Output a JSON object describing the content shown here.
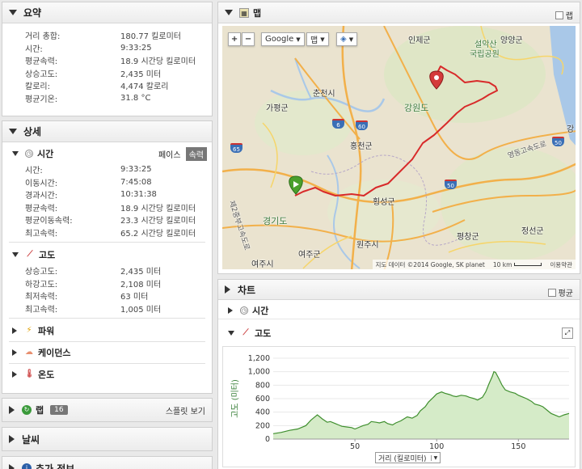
{
  "summary": {
    "title": "요약",
    "rows": [
      {
        "k": "거리 총합:",
        "v": "180.77 킬로미터"
      },
      {
        "k": "시간:",
        "v": "9:33:25"
      },
      {
        "k": "평균속력:",
        "v": "18.9 시간당 킬로미터"
      },
      {
        "k": "상승고도:",
        "v": "2,435 미터"
      },
      {
        "k": "칼로리:",
        "v": "4,474 칼로리"
      },
      {
        "k": "평균기온:",
        "v": "31.8 °C"
      }
    ]
  },
  "details": {
    "title": "상세",
    "time": {
      "title": "시간",
      "pace_label": "페이스",
      "speed_label": "속력",
      "rows": [
        {
          "k": "시간:",
          "v": "9:33:25"
        },
        {
          "k": "이동시간:",
          "v": "7:45:08"
        },
        {
          "k": "경과시간:",
          "v": "10:31:38"
        },
        {
          "k": "평균속력:",
          "v": "18.9 시간당 킬로미터"
        },
        {
          "k": "평균이동속력:",
          "v": "23.3 시간당 킬로미터"
        },
        {
          "k": "최고속력:",
          "v": "65.2 시간당 킬로미터"
        }
      ]
    },
    "elevation": {
      "title": "고도",
      "rows": [
        {
          "k": "상승고도:",
          "v": "2,435 미터"
        },
        {
          "k": "하강고도:",
          "v": "2,108 미터"
        },
        {
          "k": "최저속력:",
          "v": "63 미터"
        },
        {
          "k": "최고속력:",
          "v": "1,005 미터"
        }
      ]
    },
    "power": "파워",
    "cadence": "케이던스",
    "temperature": "온도"
  },
  "laps": {
    "title": "랩",
    "count": "16",
    "split_view": "스플릿 보기"
  },
  "weather": {
    "title": "날씨"
  },
  "extra": {
    "title": "추가 정보"
  },
  "map": {
    "title": "맵",
    "lap_checkbox": "랩",
    "zoom_in": "+",
    "zoom_out": "−",
    "provider": "Google",
    "type": "맵",
    "attribution": "지도 데이터 ©2014 Google, SK planet",
    "scale": "10 km",
    "terms": "이용약관",
    "labels": {
      "inje": "인제군",
      "yangyang": "양양군",
      "seorak": "설악산",
      "park": "국립공원",
      "chuncheon": "춘천시",
      "gapyeong": "가평군",
      "gangwon": "강원도",
      "hongcheon": "홍천군",
      "gyeonggi": "경기도",
      "hoengseong": "횡성군",
      "wonju": "원주시",
      "yeoju": "여주군",
      "pyeongchang": "평창군",
      "jeongseon": "정선군",
      "yeosu": "여주시",
      "gang": "강",
      "expressway1": "영동고속도로",
      "expressway2": "제2중부고속도로",
      "route_6": "6",
      "route_60": "60",
      "route_65": "65",
      "route_50": "50"
    }
  },
  "chart": {
    "title": "차트",
    "avg_checkbox": "평균",
    "time_section": "시간",
    "elevation_section": "고도",
    "xaxis_select": "거리 (킬로미터)"
  },
  "chart_data": {
    "type": "area",
    "ylabel": "고도 (미터)",
    "xlabel": "거리 (킬로미터)",
    "xlim": [
      0,
      181
    ],
    "ylim": [
      0,
      1200
    ],
    "xticks": [
      50,
      100,
      150
    ],
    "yticks": [
      0,
      200,
      400,
      600,
      800,
      1000,
      1200
    ],
    "ytick_labels": [
      "0",
      "200",
      "400",
      "600",
      "800",
      "1,000",
      "1,200"
    ],
    "x": [
      0,
      5,
      10,
      15,
      20,
      23,
      25,
      27,
      30,
      33,
      35,
      38,
      40,
      42,
      45,
      48,
      50,
      53,
      55,
      58,
      60,
      63,
      65,
      68,
      70,
      73,
      75,
      78,
      80,
      82,
      85,
      88,
      90,
      93,
      95,
      98,
      100,
      103,
      105,
      108,
      110,
      112,
      115,
      118,
      120,
      123,
      125,
      128,
      130,
      132,
      134,
      135,
      136,
      138,
      140,
      142,
      145,
      148,
      150,
      153,
      155,
      158,
      160,
      163,
      165,
      168,
      170,
      173,
      175,
      178,
      181
    ],
    "y": [
      80,
      100,
      130,
      150,
      200,
      280,
      320,
      360,
      300,
      250,
      260,
      230,
      210,
      190,
      180,
      170,
      150,
      180,
      200,
      220,
      260,
      250,
      240,
      260,
      230,
      210,
      240,
      270,
      300,
      330,
      310,
      350,
      420,
      480,
      550,
      620,
      670,
      700,
      680,
      660,
      640,
      630,
      650,
      640,
      620,
      600,
      580,
      620,
      700,
      820,
      930,
      1000,
      990,
      900,
      800,
      730,
      700,
      680,
      650,
      620,
      600,
      560,
      520,
      500,
      480,
      420,
      380,
      350,
      330,
      360,
      380
    ]
  }
}
